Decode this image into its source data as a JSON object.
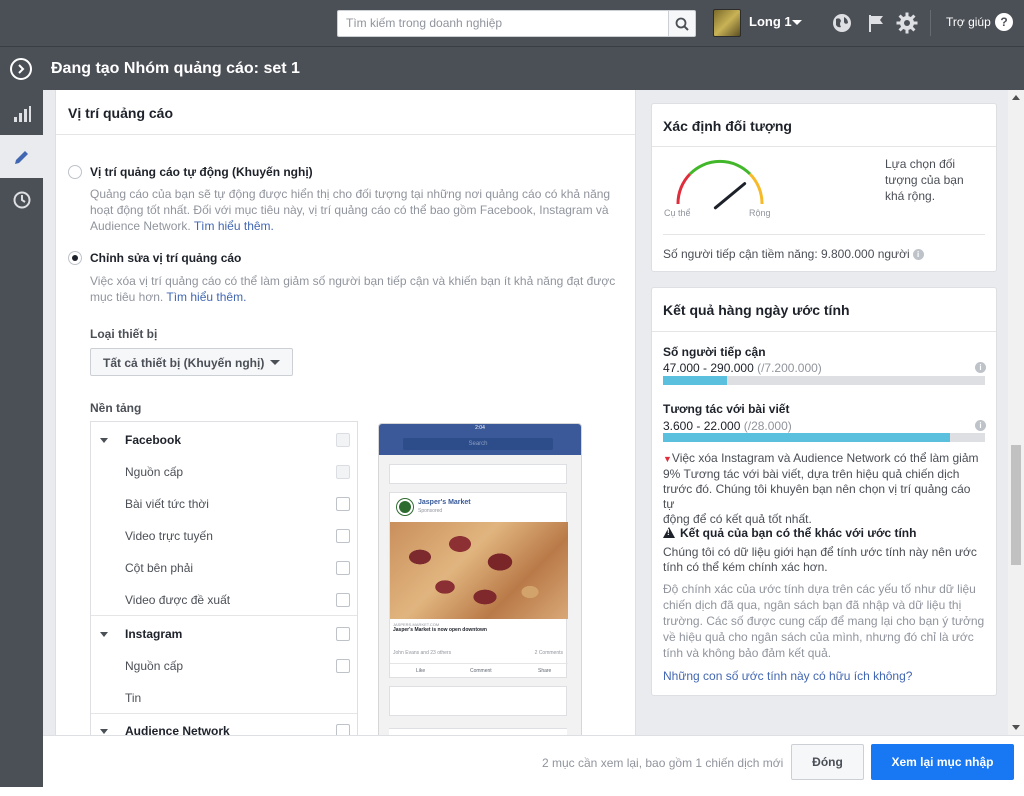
{
  "topbar": {
    "search_placeholder": "Tìm kiếm trong doanh nghiệp",
    "account_name": "Long 1",
    "help_label": "Trợ giúp",
    "icons": [
      "search-icon",
      "globe-icon",
      "flag-icon",
      "gear-icon",
      "help-icon"
    ]
  },
  "header": {
    "title": "Đang tạo Nhóm quảng cáo: set 1"
  },
  "placement": {
    "section_title": "Vị trí quảng cáo",
    "auto": {
      "title": "Vị trí quảng cáo tự động (Khuyến nghị)",
      "desc_line1": "Quảng cáo của bạn sẽ tự động được hiển thị cho đối tượng tại những nơi quảng cáo có khả năng",
      "desc_line2": "hoạt động tốt nhất. Đối với mục tiêu này, vị trí quảng cáo có thể bao gồm Facebook, Instagram và",
      "desc_line3": "Audience Network.",
      "link": "Tìm hiểu thêm.",
      "selected": false
    },
    "edit": {
      "title": "Chỉnh sửa vị trí quảng cáo",
      "desc_line1": "Việc xóa vị trí quảng cáo có thể làm giảm số người bạn tiếp cận và khiến bạn ít khả năng đạt được",
      "desc_line2": "mục tiêu hơn.",
      "link": "Tìm hiểu thêm.",
      "selected": true
    },
    "device_label": "Loại thiết bị",
    "device_value": "Tất cả thiết bị (Khuyến nghị)",
    "platforms_label": "Nền tảng",
    "platforms": {
      "facebook": "Facebook",
      "fb_feed": "Nguồn cấp",
      "fb_instant": "Bài viết tức thời",
      "fb_video": "Video trực tuyến",
      "fb_right": "Cột bên phải",
      "fb_suggested": "Video được đề xuất",
      "instagram": "Instagram",
      "ig_feed": "Nguồn cấp",
      "ig_stories": "Tin",
      "audience_network": "Audience Network"
    },
    "preview": {
      "time": "2:04",
      "search": "Search",
      "page_name": "Jasper's Market",
      "sponsored": "Sponsored",
      "url": "JASPERS-MARKET.COM",
      "headline": "Jasper's Market is now open downtown",
      "social": "John Evans and 23 others",
      "comments": "2 Comments",
      "like": "Like",
      "comment": "Comment",
      "share": "Share"
    }
  },
  "audience": {
    "title": "Xác định đối tượng",
    "gauge_left": "Cụ thể",
    "gauge_right": "Rộng",
    "gauge_level": 0.78,
    "description_l1": "Lựa chọn đối",
    "description_l2": "tượng của bạn",
    "description_l3": "khá rộng.",
    "potential_reach": "Số người tiếp cận tiềm năng: 9.800.000 người"
  },
  "estimates": {
    "title": "Kết quả hàng ngày ước tính",
    "reach_label": "Số người tiếp cận",
    "reach_range": "47.000 - 290.000",
    "reach_total": "(/7.200.000)",
    "reach_fill": 0.2,
    "engagement_label": "Tương tác với bài viết",
    "engagement_range": "3.600 - 22.000",
    "engagement_total": "(/28.000)",
    "engagement_fill": 0.89,
    "note_l1": "Việc xóa Instagram và Audience Network có thể làm giảm",
    "note_l2": "9% Tương tác với bài viết, dựa trên hiệu quả chiến dịch",
    "note_l3": "trước đó. Chúng tôi khuyên bạn nên chọn vị trí quảng cáo tự",
    "note_l4": "động để có kết quả tốt nhất.",
    "warn_title": "Kết quả của bạn có thể khác với ước tính",
    "warn_l1": "Chúng tôi có dữ liệu giới hạn để tính ước tính này nên ước",
    "warn_l2": "tính có thể kém chính xác hơn.",
    "acc_l1": "Độ chính xác của ước tính dựa trên các yếu tố như dữ liệu",
    "acc_l2": "chiến dịch đã qua, ngân sách bạn đã nhập và dữ liệu thị",
    "acc_l3": "trường. Các số được cung cấp để mang lại cho bạn ý tưởng",
    "acc_l4": "về hiệu quả cho ngân sách của mình, nhưng đó chỉ là ước",
    "acc_l5": "tính và không bảo đảm kết quả.",
    "feedback_link": "Những con số ước tính này có hữu ích không?"
  },
  "footer": {
    "status": "2 mục cần xem lại, bao gồm 1 chiến dịch mới",
    "close_label": "Đóng",
    "review_label": "Xem lại mục nhập"
  },
  "colors": {
    "topbar": "#4b4f56",
    "primary": "#1877f2",
    "bar_fill": "#5bc0de",
    "link": "#4267b2"
  }
}
